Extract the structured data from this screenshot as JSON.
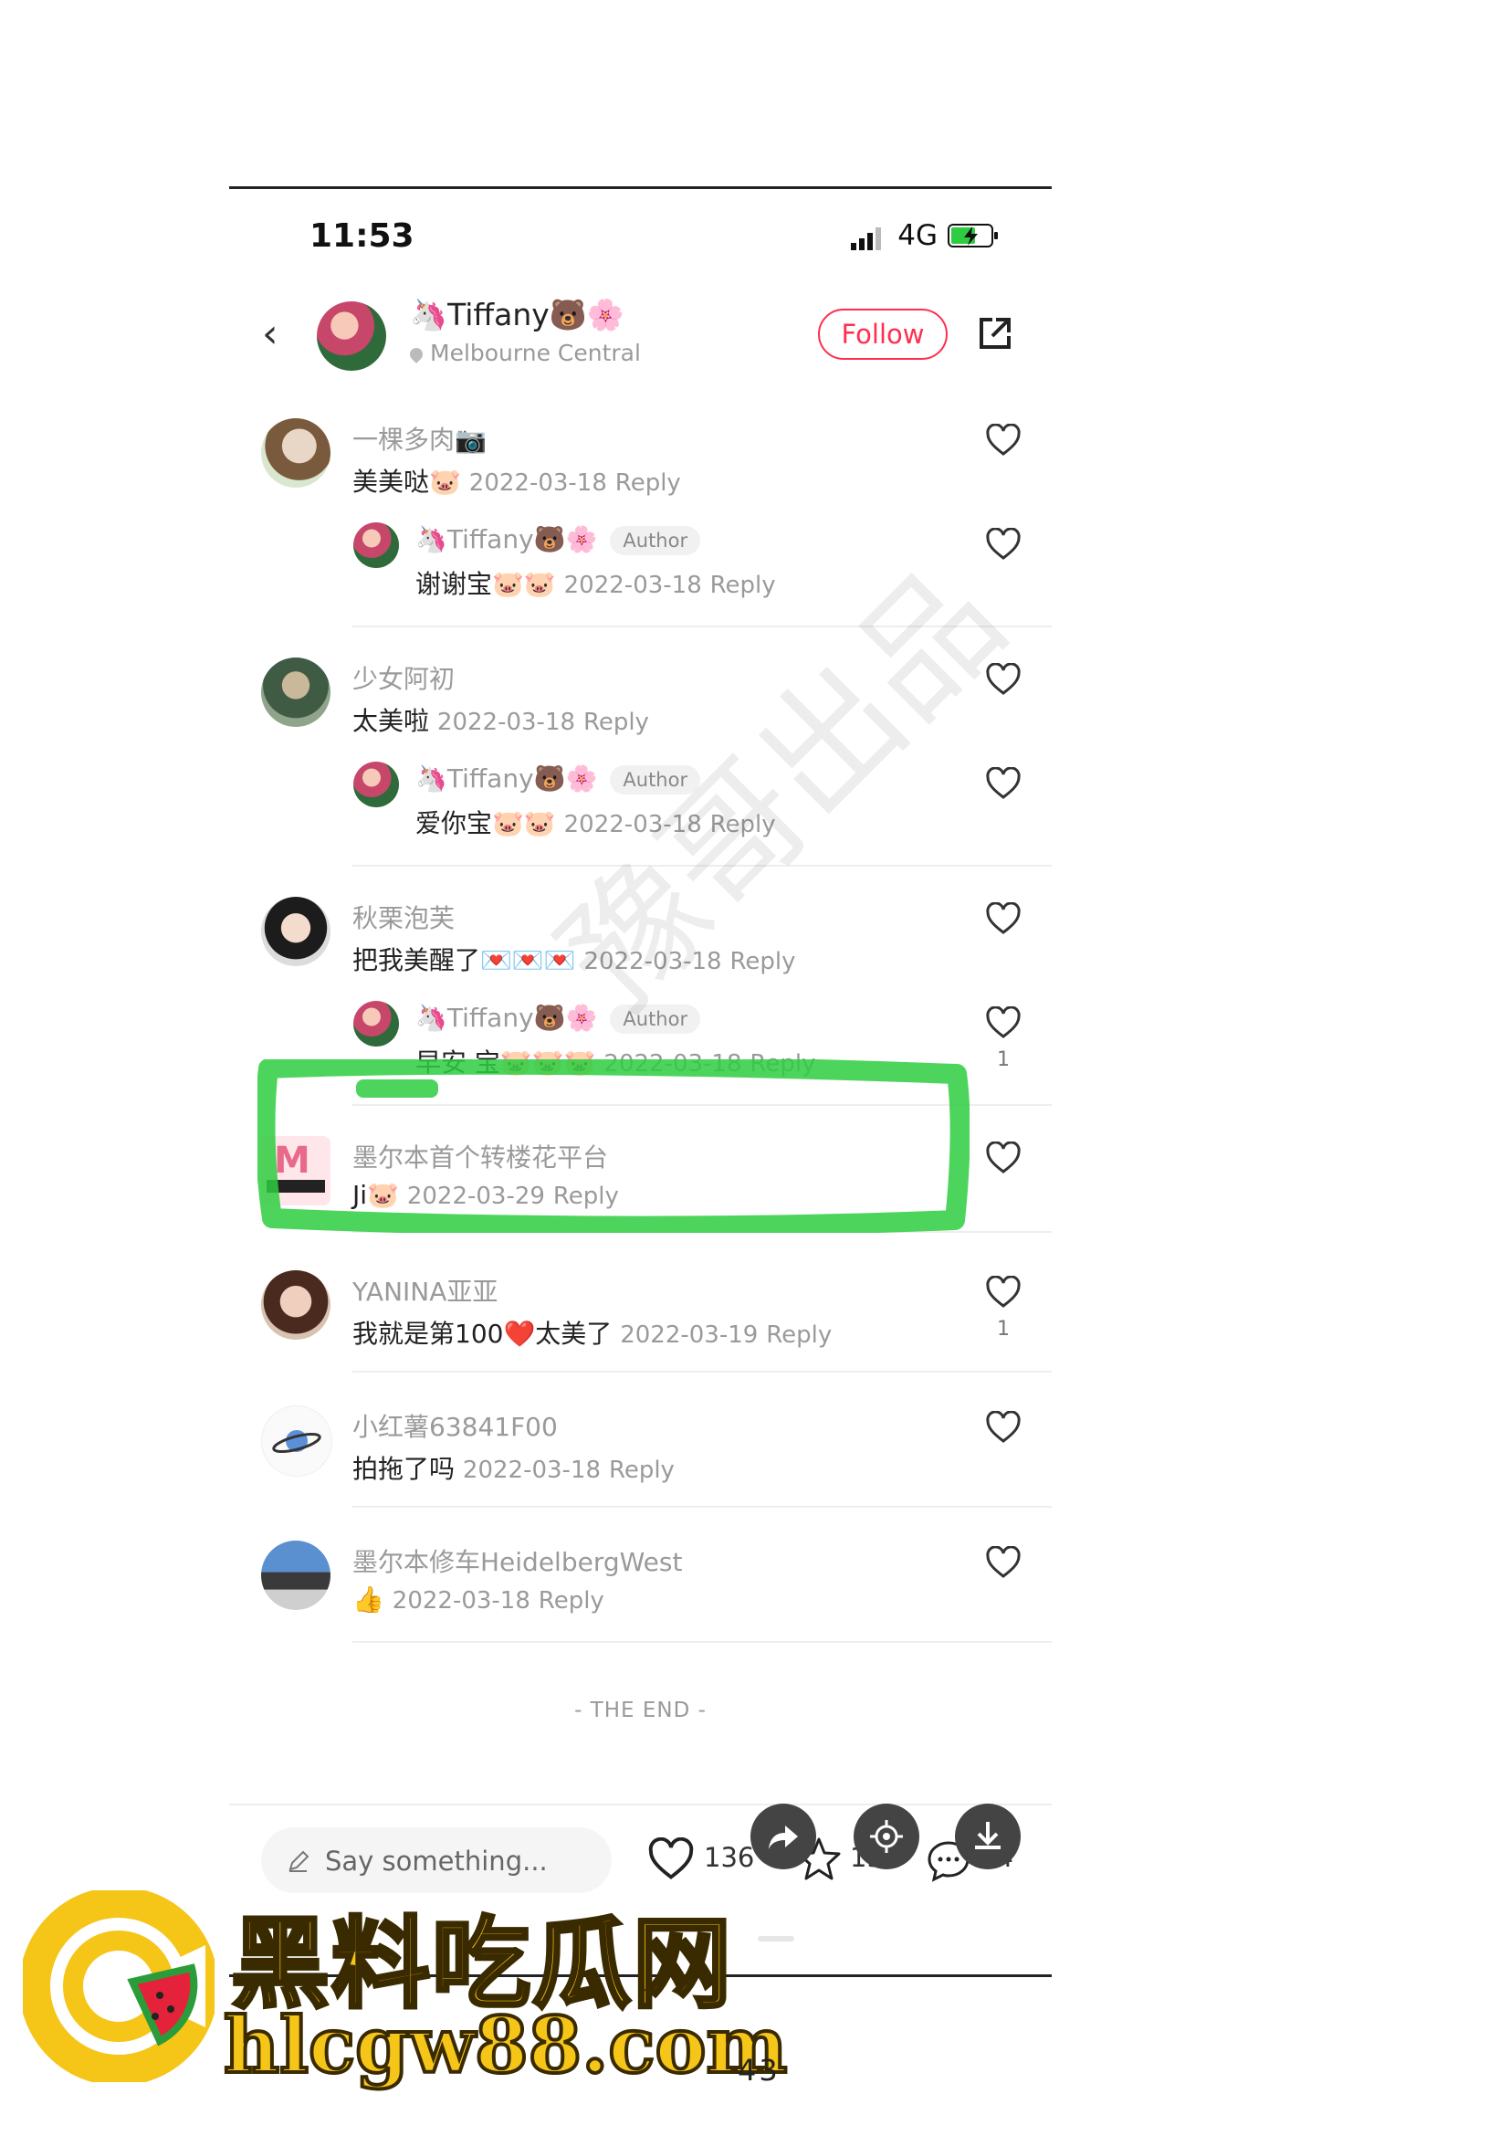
{
  "status_bar": {
    "time": "11:53",
    "network": "4G"
  },
  "header": {
    "author_name": "🦄Tiffany🐻🌸",
    "location": "Melbourne Central",
    "follow_label": "Follow"
  },
  "comments": [
    {
      "user": "一棵多肉📷",
      "text": "美美哒🐷",
      "date": "2022-03-18",
      "reply_label": "Reply",
      "reply": {
        "user": "🦄Tiffany🐻🌸",
        "badge": "Author",
        "text": "谢谢宝🐷🐷",
        "date": "2022-03-18",
        "reply_label": "Reply"
      }
    },
    {
      "user": "少女阿初",
      "text": "太美啦",
      "date": "2022-03-18",
      "reply_label": "Reply",
      "reply": {
        "user": "🦄Tiffany🐻🌸",
        "badge": "Author",
        "text": "爱你宝🐷🐷",
        "date": "2022-03-18",
        "reply_label": "Reply"
      }
    },
    {
      "user": "秋栗泡芙",
      "text": "把我美醒了💌💌💌",
      "date": "2022-03-18",
      "reply_label": "Reply",
      "reply": {
        "user": "🦄Tiffany🐻🌸",
        "badge": "Author",
        "text": "早安 宝🐷🐷🐷",
        "date": "2022-03-18",
        "reply_label": "Reply",
        "likes": "1"
      }
    },
    {
      "user": "墨尔本首个转楼花平台",
      "text": "Ji🐷",
      "date": "2022-03-29",
      "reply_label": "Reply"
    },
    {
      "user": "YANINA亚亚",
      "text": "我就是第100❤️太美了",
      "date": "2022-03-19",
      "reply_label": "Reply",
      "likes": "1"
    },
    {
      "user": "小红薯63841F00",
      "text": "拍拖了吗",
      "date": "2022-03-18",
      "reply_label": "Reply"
    },
    {
      "user": "墨尔本修车HeidelbergWest",
      "text": "👍",
      "date": "2022-03-18",
      "reply_label": "Reply"
    }
  ],
  "end_text": "- THE END -",
  "bottom_bar": {
    "input_placeholder": "Say something...",
    "likes": "136",
    "stars": "15",
    "comments": "24"
  },
  "watermark_text": "豫哥出品",
  "brand": {
    "name": "黑料吃瓜网",
    "url": "hlcgw88.com"
  },
  "page_number": "43",
  "colors": {
    "accent": "#ff2e4d",
    "highlight": "#2ecc40",
    "brand_yellow": "#f5c518"
  }
}
